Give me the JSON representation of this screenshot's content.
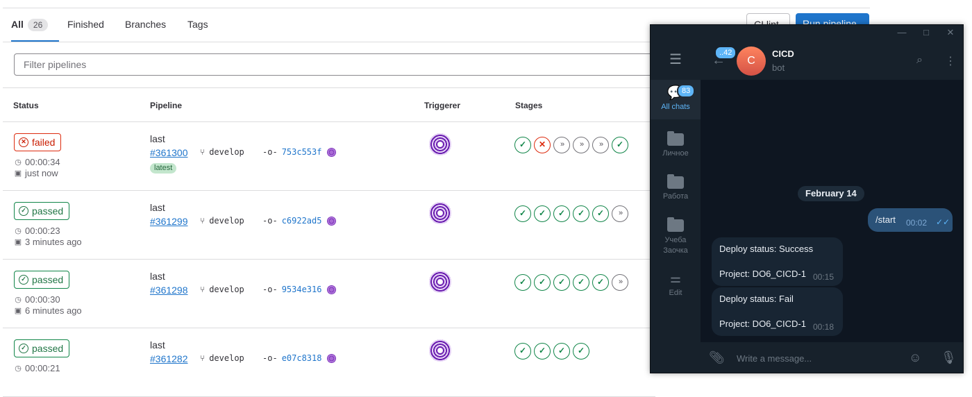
{
  "tabs": [
    {
      "label": "All",
      "count": "26"
    },
    {
      "label": "Finished"
    },
    {
      "label": "Branches"
    },
    {
      "label": "Tags"
    }
  ],
  "buttons": {
    "ci_lint": "CI lint",
    "run_pipeline": "Run pipeline"
  },
  "filter": {
    "placeholder": "Filter pipelines"
  },
  "table": {
    "headers": [
      "Status",
      "Pipeline",
      "Triggerer",
      "Stages"
    ],
    "rows": [
      {
        "status": "failed",
        "duration": "00:00:34",
        "finished": "just now",
        "name": "last",
        "id": "#361300",
        "branch": "develop",
        "commit": "753c553f",
        "tag": "latest",
        "stages": [
          "success",
          "failed",
          "skipped",
          "skipped",
          "skipped",
          "success"
        ]
      },
      {
        "status": "passed",
        "duration": "00:00:23",
        "finished": "3 minutes ago",
        "name": "last",
        "id": "#361299",
        "branch": "develop",
        "commit": "c6922ad5",
        "stages": [
          "success",
          "success",
          "success",
          "success",
          "success",
          "skipped"
        ]
      },
      {
        "status": "passed",
        "duration": "00:00:30",
        "finished": "6 minutes ago",
        "name": "last",
        "id": "#361298",
        "branch": "develop",
        "commit": "9534e316",
        "stages": [
          "success",
          "success",
          "success",
          "success",
          "success",
          "skipped"
        ]
      },
      {
        "status": "passed",
        "duration": "00:00:21",
        "finished": "",
        "name": "last",
        "id": "#361282",
        "branch": "develop",
        "commit": "e07c8318",
        "stages": [
          "success",
          "success",
          "success",
          "success"
        ]
      }
    ]
  },
  "telegram": {
    "folders": [
      {
        "label": "All chats",
        "badge": "83"
      },
      {
        "label": "Личное"
      },
      {
        "label": "Работа"
      },
      {
        "label": "Учеба Заочка"
      },
      {
        "label": "Edit"
      }
    ],
    "back_badge": "..42",
    "chat": {
      "avatar_letter": "C",
      "name": "CICD",
      "subtitle": "bot"
    },
    "date": "February 14",
    "out_message": {
      "text": "/start",
      "time": "00:02"
    },
    "in_messages": [
      {
        "line1": "Deploy status: Success",
        "line2": "Project: DO6_CICD-1",
        "time": "00:15"
      },
      {
        "line1": "Deploy status: Fail",
        "line2": "Project: DO6_CICD-1",
        "time": "00:18"
      }
    ],
    "composer_placeholder": "Write a message..."
  }
}
